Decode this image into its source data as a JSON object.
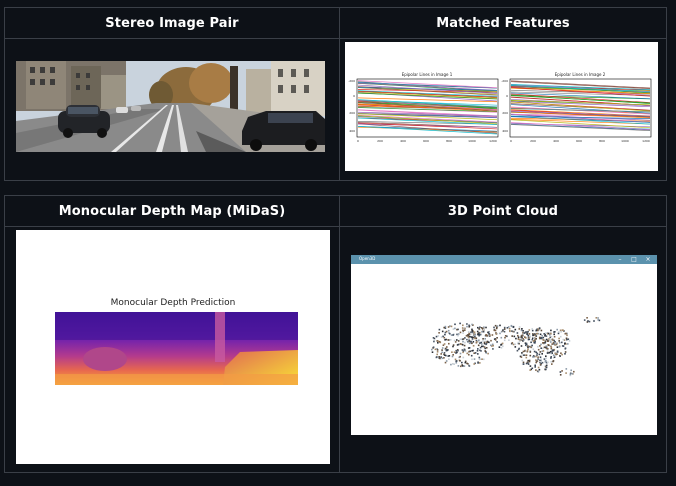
{
  "panels": {
    "stereo": {
      "title": "Stereo Image Pair"
    },
    "matched": {
      "title": "Matched Features",
      "plot_left_title": "Epipolar Lines in Image 1",
      "plot_right_title": "Epipolar Lines in Image 2",
      "y_ticks": [
        "-200",
        "0",
        "200",
        "400"
      ],
      "x_ticks": [
        "0",
        "200",
        "400",
        "600",
        "800",
        "1000",
        "1200"
      ]
    },
    "depth": {
      "title": "Monocular Depth Map (MiDaS)",
      "plot_title": "Monocular Depth Prediction"
    },
    "pointcloud": {
      "title": "3D Point Cloud",
      "window_title": "Open3D",
      "window_buttons": [
        "–",
        "□",
        "×"
      ]
    }
  },
  "colors": {
    "background": "#0d1117",
    "border": "#3a3f47",
    "open3d_titlebar": "#5b92ad"
  }
}
